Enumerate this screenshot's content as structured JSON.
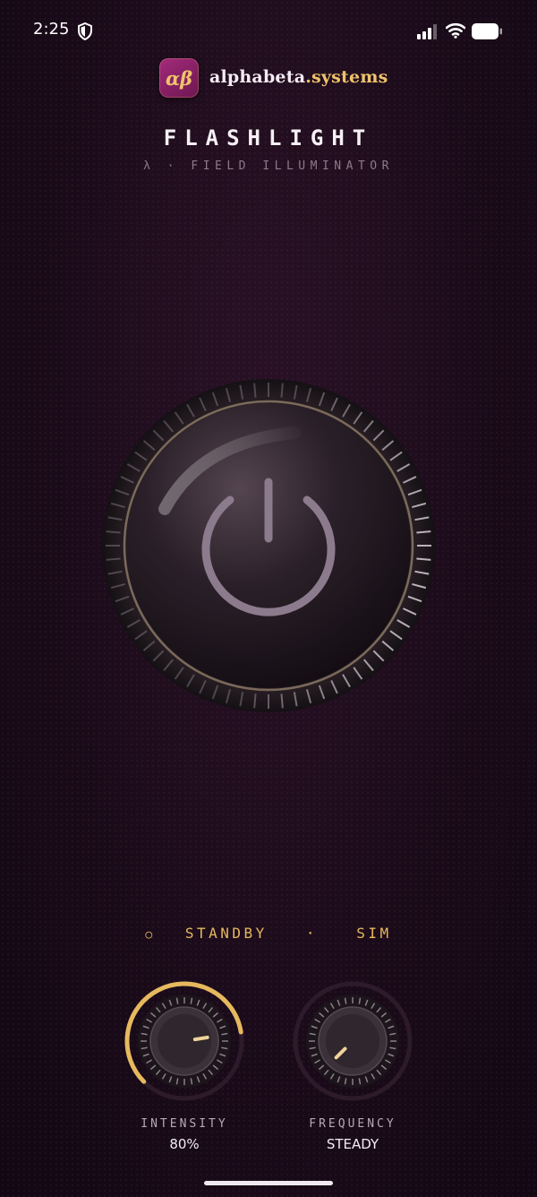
{
  "status_bar": {
    "time": "2:25",
    "icons": [
      "shield-icon",
      "cellular-signal-icon",
      "wifi-icon",
      "battery-icon"
    ]
  },
  "brand": {
    "logo_text": "αβ",
    "name": "alphabeta",
    "tld": ".systems"
  },
  "header": {
    "title": "FLASHLIGHT",
    "subtitle": "λ · FIELD ILLUMINATOR"
  },
  "power_button": {
    "icon": "power-icon"
  },
  "status": {
    "indicator": "○",
    "state": "STANDBY",
    "separator": "·",
    "mode": "SIM"
  },
  "controls": {
    "intensity": {
      "label": "INTENSITY",
      "value": "80%",
      "level": 0.8
    },
    "frequency": {
      "label": "FREQUENCY",
      "value": "STEADY",
      "level": 0
    }
  },
  "colors": {
    "accent": "#E6B95E",
    "background": "#1B0B1A",
    "logo": "#8E2268"
  }
}
